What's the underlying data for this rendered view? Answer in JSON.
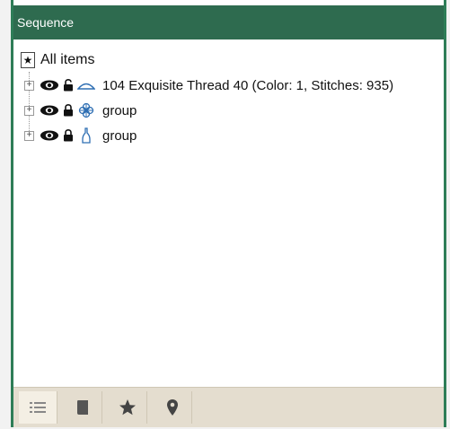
{
  "panel": {
    "title": "Sequence"
  },
  "tree": {
    "root_label": "All items",
    "root_icon": "star-box-icon",
    "items": [
      {
        "label": "104 Exquisite Thread 40 (Color: 1, Stitches: 935)",
        "type_icon": "outline-arc-icon"
      },
      {
        "label": "group",
        "type_icon": "flower-motif-icon"
      },
      {
        "label": "group",
        "type_icon": "bottle-motif-icon"
      }
    ]
  },
  "tabs": [
    {
      "name": "list-tab",
      "icon": "list-icon",
      "active": true
    },
    {
      "name": "book-tab",
      "icon": "book-icon",
      "active": false
    },
    {
      "name": "favorites-tab",
      "icon": "star-icon",
      "active": false
    },
    {
      "name": "location-tab",
      "icon": "pin-icon",
      "active": false
    }
  ],
  "colors": {
    "titlebar": "#2e6b4f",
    "border": "#2e7d57",
    "tabbar": "#e4ddcf",
    "motif_blue": "#2f6fb3"
  }
}
